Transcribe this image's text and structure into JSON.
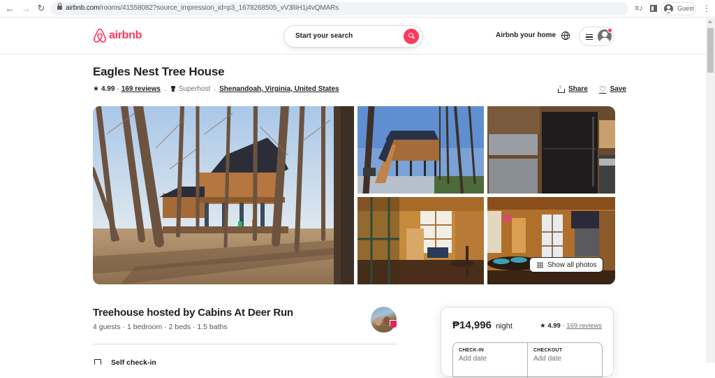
{
  "browser": {
    "url_host": "airbnb.com",
    "url_path": "/rooms/41558082?source_impression_id=p3_1678268505_vV3lIiH1j4vQMARs",
    "profile_label": "Guest"
  },
  "header": {
    "logo_text": "airbnb",
    "search_placeholder": "Start your search",
    "host_link": "Airbnb your home",
    "brand_color": "#ff385c"
  },
  "listing": {
    "title": "Eagles Nest Tree House",
    "rating": "4.99",
    "rating_sep": "·",
    "reviews_link": "169 reviews",
    "superhost_label": "Superhost",
    "location": "Shenandoah, Virginia, United States",
    "share_label": "Share",
    "save_label": "Save"
  },
  "gallery": {
    "photos": [
      {
        "alt": "Treehouse exterior in forest"
      },
      {
        "alt": "Treehouse with staircase"
      },
      {
        "alt": "Kitchen with refrigerator and washer"
      },
      {
        "alt": "Kitchen and living area"
      },
      {
        "alt": "Dining area"
      }
    ],
    "show_all_label": "Show all photos"
  },
  "host": {
    "title": "Treehouse hosted by Cabins At Deer Run",
    "details": "4 guests · 1 bedroom · 2 beds · 1.5 baths",
    "highlight": "Self check-in"
  },
  "booking": {
    "price": "₱14,996",
    "per": "night",
    "rating": "4.99",
    "reviews_link": "169 reviews",
    "checkin_label": "CHECK-IN",
    "checkin_value": "Add date",
    "checkout_label": "CHECKOUT",
    "checkout_value": "Add date"
  }
}
